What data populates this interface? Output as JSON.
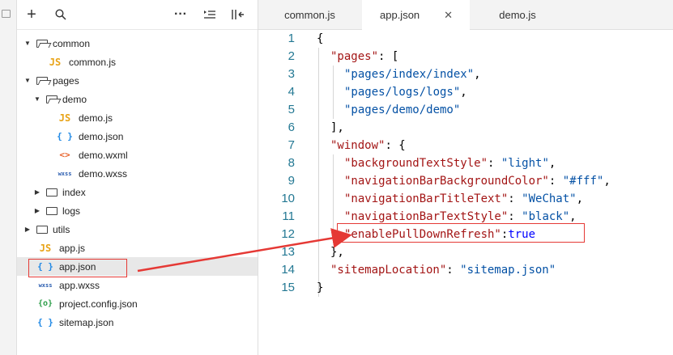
{
  "toolbar": {
    "add_icon": "+",
    "search_icon": "⚲",
    "more_icon": "···",
    "sort_icon": "≣",
    "collapse_icon": "⇤"
  },
  "tree": [
    {
      "label": "common",
      "type": "folder",
      "open": true,
      "depth": 0
    },
    {
      "label": "common.js",
      "type": "js",
      "depth": 1
    },
    {
      "label": "pages",
      "type": "folder",
      "open": true,
      "depth": 0
    },
    {
      "label": "demo",
      "type": "folder",
      "open": true,
      "depth": 1
    },
    {
      "label": "demo.js",
      "type": "js",
      "depth": 2
    },
    {
      "label": "demo.json",
      "type": "json",
      "depth": 2
    },
    {
      "label": "demo.wxml",
      "type": "wxml",
      "depth": 2
    },
    {
      "label": "demo.wxss",
      "type": "wxss",
      "depth": 2
    },
    {
      "label": "index",
      "type": "folder",
      "open": false,
      "depth": 1
    },
    {
      "label": "logs",
      "type": "folder",
      "open": false,
      "depth": 1
    },
    {
      "label": "utils",
      "type": "folder",
      "open": false,
      "depth": 0
    },
    {
      "label": "app.js",
      "type": "js",
      "depth": 0
    },
    {
      "label": "app.json",
      "type": "json",
      "depth": 0,
      "selected": true
    },
    {
      "label": "app.wxss",
      "type": "wxss",
      "depth": 0
    },
    {
      "label": "project.config.json",
      "type": "config",
      "depth": 0
    },
    {
      "label": "sitemap.json",
      "type": "json",
      "depth": 0
    }
  ],
  "icons": {
    "js": "JS",
    "json": "{ }",
    "wxml": "<>",
    "wxss": "wxss",
    "config": "{o}"
  },
  "tabs": [
    {
      "label": "common.js",
      "active": false
    },
    {
      "label": "app.json",
      "active": true
    },
    {
      "label": "demo.js",
      "active": false
    }
  ],
  "tab_close": "✕",
  "code_lines": [
    {
      "n": "1",
      "indent": 0,
      "tokens": [
        [
          "p",
          "{"
        ]
      ]
    },
    {
      "n": "2",
      "indent": 1,
      "tokens": [
        [
          "k",
          "\"pages\""
        ],
        [
          "p",
          ": ["
        ]
      ]
    },
    {
      "n": "3",
      "indent": 2,
      "tokens": [
        [
          "s",
          "\"pages/index/index\""
        ],
        [
          "p",
          ","
        ]
      ]
    },
    {
      "n": "4",
      "indent": 2,
      "tokens": [
        [
          "s",
          "\"pages/logs/logs\""
        ],
        [
          "p",
          ","
        ]
      ]
    },
    {
      "n": "5",
      "indent": 2,
      "tokens": [
        [
          "s",
          "\"pages/demo/demo\""
        ]
      ]
    },
    {
      "n": "6",
      "indent": 1,
      "tokens": [
        [
          "p",
          "],"
        ]
      ]
    },
    {
      "n": "7",
      "indent": 1,
      "tokens": [
        [
          "k",
          "\"window\""
        ],
        [
          "p",
          ": {"
        ]
      ]
    },
    {
      "n": "8",
      "indent": 2,
      "tokens": [
        [
          "k",
          "\"backgroundTextStyle\""
        ],
        [
          "p",
          ": "
        ],
        [
          "s",
          "\"light\""
        ],
        [
          "p",
          ","
        ]
      ]
    },
    {
      "n": "9",
      "indent": 2,
      "tokens": [
        [
          "k",
          "\"navigationBarBackgroundColor\""
        ],
        [
          "p",
          ": "
        ],
        [
          "s",
          "\"#fff\""
        ],
        [
          "p",
          ","
        ]
      ]
    },
    {
      "n": "10",
      "indent": 2,
      "tokens": [
        [
          "k",
          "\"navigationBarTitleText\""
        ],
        [
          "p",
          ": "
        ],
        [
          "s",
          "\"WeChat\""
        ],
        [
          "p",
          ","
        ]
      ]
    },
    {
      "n": "11",
      "indent": 2,
      "tokens": [
        [
          "k",
          "\"navigationBarTextStyle\""
        ],
        [
          "p",
          ": "
        ],
        [
          "s",
          "\"black\""
        ],
        [
          "p",
          ","
        ]
      ]
    },
    {
      "n": "12",
      "indent": 2,
      "tokens": [
        [
          "k",
          "\"enablePullDownRefresh\""
        ],
        [
          "p",
          ":"
        ],
        [
          "b",
          "true"
        ]
      ]
    },
    {
      "n": "13",
      "indent": 1,
      "tokens": [
        [
          "p",
          "},"
        ]
      ]
    },
    {
      "n": "14",
      "indent": 1,
      "tokens": [
        [
          "k",
          "\"sitemapLocation\""
        ],
        [
          "p",
          ": "
        ],
        [
          "s",
          "\"sitemap.json\""
        ]
      ]
    },
    {
      "n": "15",
      "indent": 0,
      "tokens": [
        [
          "p",
          "}"
        ]
      ]
    }
  ],
  "colors": {
    "line_number": "#237893",
    "key": "#a31515",
    "string": "#0451a5",
    "boolean": "#0000ff",
    "annotation": "#e53935"
  }
}
